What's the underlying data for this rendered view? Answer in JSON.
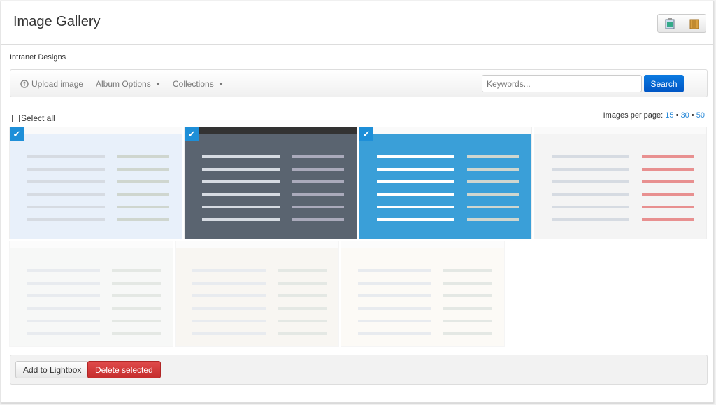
{
  "header": {
    "title": "Image Gallery",
    "buttons": [
      {
        "icon": "image-icon"
      },
      {
        "icon": "box-icon"
      }
    ]
  },
  "album": {
    "name": "Intranet Designs"
  },
  "toolbar": {
    "upload": "Upload image",
    "album_options": "Album Options",
    "collections": "Collections",
    "keywords_placeholder": "Keywords...",
    "search": "Search"
  },
  "selection": {
    "select_all": "Select all"
  },
  "pagination": {
    "label": "Images per page:",
    "options": [
      "15",
      "30",
      "50"
    ],
    "sep": "•"
  },
  "images": [
    {
      "selected": true,
      "color": "#e8f0fa"
    },
    {
      "selected": true,
      "color": "#5a6470"
    },
    {
      "selected": true,
      "color": "#3a9fd8"
    },
    {
      "selected": false,
      "color": "#f4f4f4"
    },
    {
      "selected": false,
      "color": "#f2f4f2"
    },
    {
      "selected": false,
      "color": "#f3efe8"
    },
    {
      "selected": false,
      "color": "#fbf6f0"
    }
  ],
  "footer": {
    "add_lightbox": "Add to Lightbox",
    "delete_selected": "Delete selected"
  },
  "colors": {
    "accent": "#0b6fd6",
    "danger": "#d33b3b",
    "link": "#2a8ad8"
  }
}
